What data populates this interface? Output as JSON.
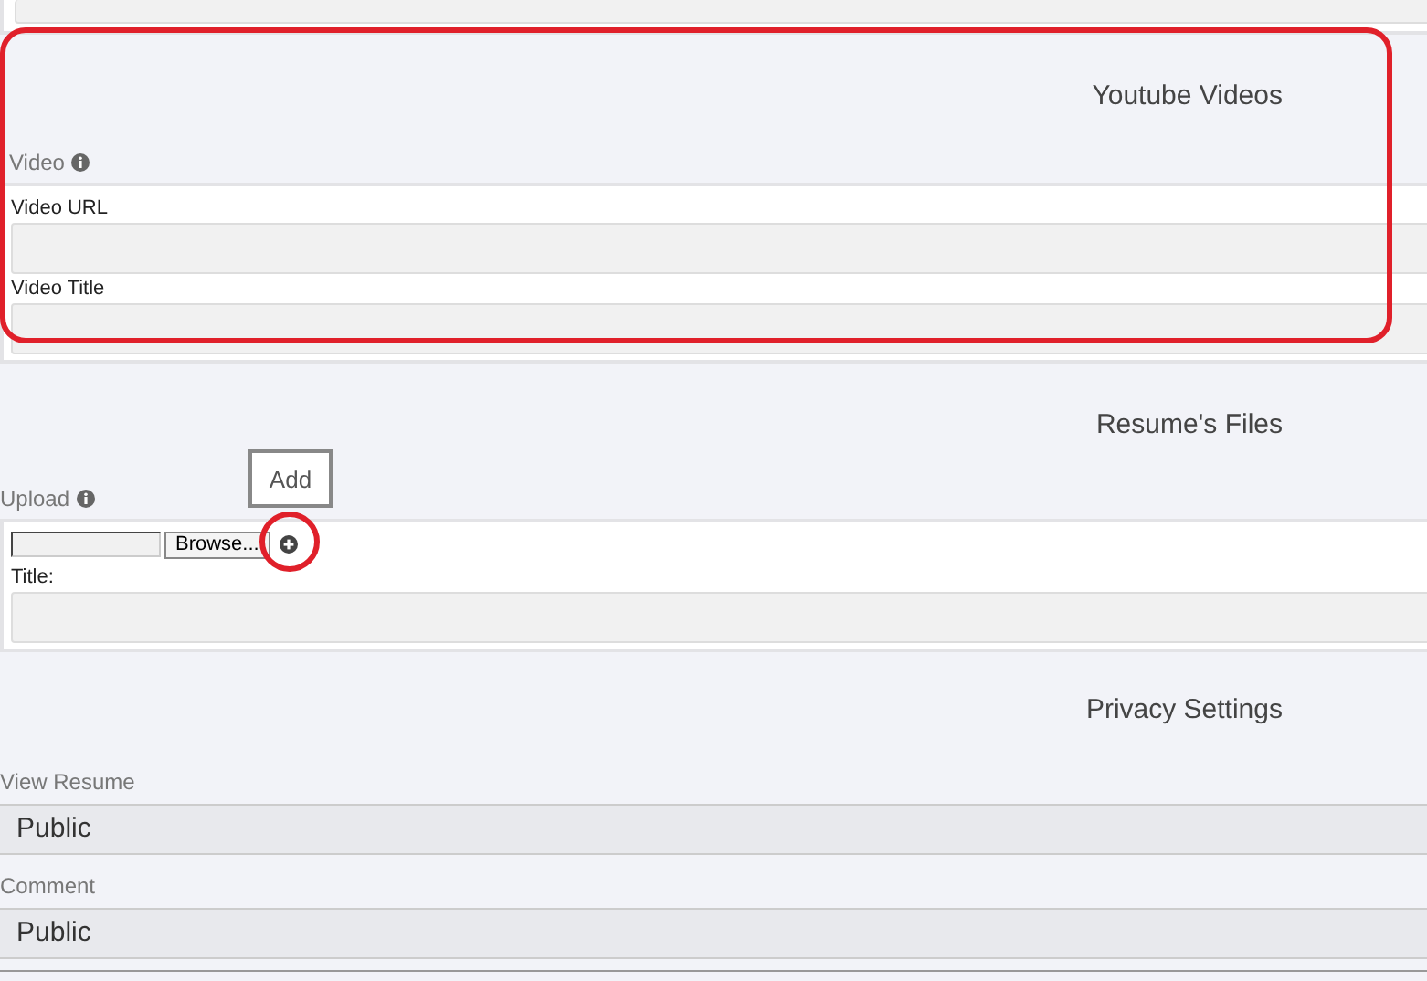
{
  "sections": [
    {
      "heading": "Youtube Videos",
      "label": "Video",
      "info": true,
      "highlighted": true,
      "fields": [
        {
          "label": "Video URL"
        },
        {
          "label": "Video Title"
        }
      ]
    },
    {
      "heading": "Resume's Files",
      "label": "Upload",
      "info": true,
      "highlighted": false,
      "add_button": "Add",
      "upload": {
        "browse": "Browse...",
        "add_circled": true,
        "title_label": "Title:"
      }
    },
    {
      "heading": "Privacy Settings",
      "selects": [
        {
          "label": "View Resume",
          "value": "Public"
        },
        {
          "label": "Comment",
          "value": "Public"
        }
      ]
    }
  ]
}
